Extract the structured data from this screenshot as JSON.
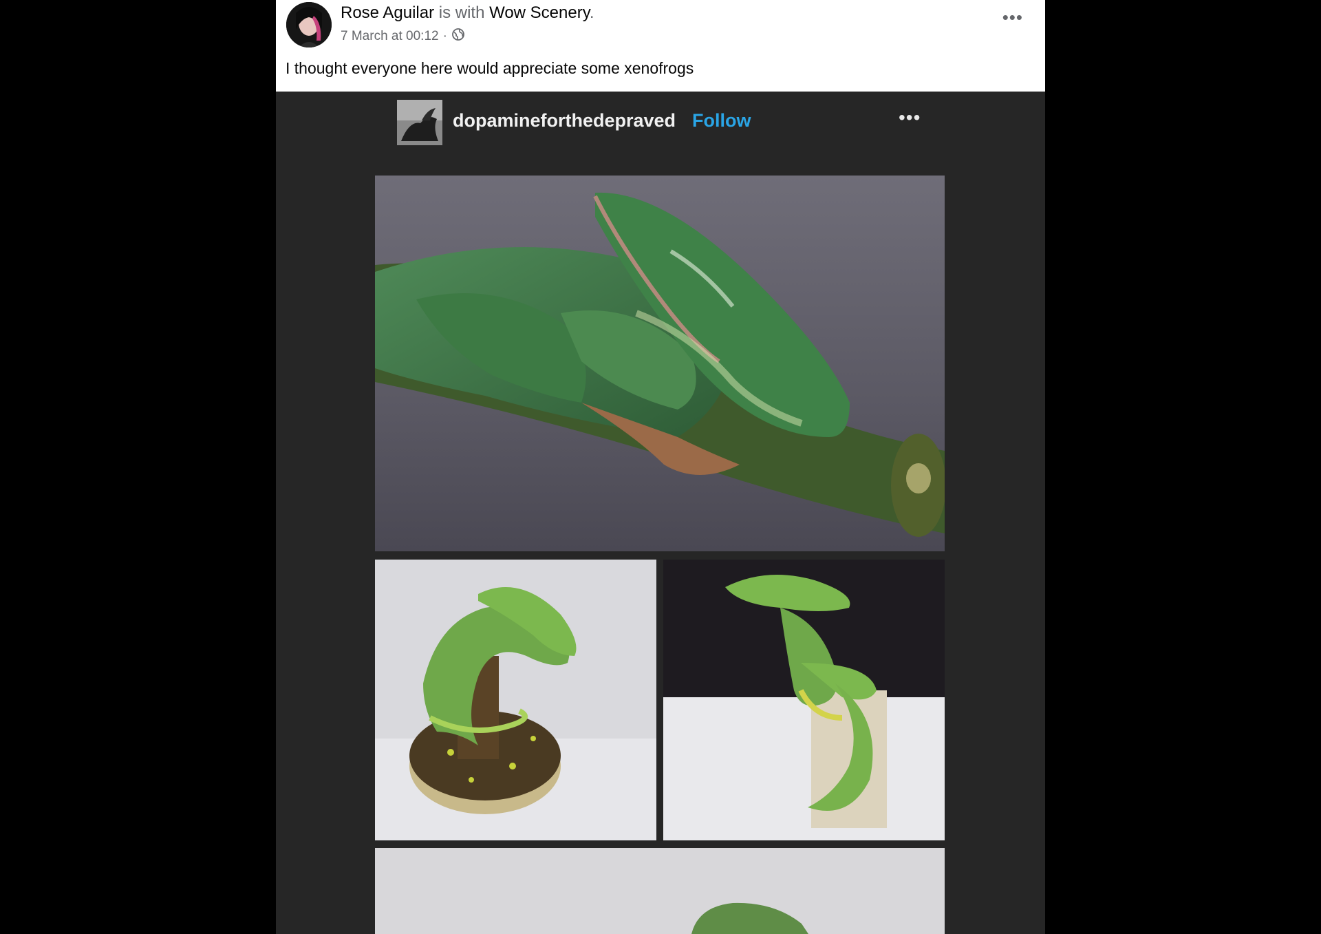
{
  "post": {
    "author": "Rose Aguilar",
    "with_connector": " is with ",
    "tagged_page": "Wow Scenery",
    "tagged_suffix": ".",
    "timestamp": "7 March at 00:12",
    "separator": "·",
    "privacy_icon": "globe-icon",
    "more_icon": "more-horizontal-icon",
    "more_glyph": "•••",
    "caption": "I thought everyone here would appreciate some xenofrogs"
  },
  "embed": {
    "username": "dopamineforthedepraved",
    "follow_label": "Follow",
    "more_glyph": "•••",
    "more_icon": "more-horizontal-icon"
  },
  "colors": {
    "page_background": "#000000",
    "card_background": "#ffffff",
    "embed_background": "#262626",
    "follow_accent": "#2aa5e6",
    "muted_text": "#65676b"
  }
}
